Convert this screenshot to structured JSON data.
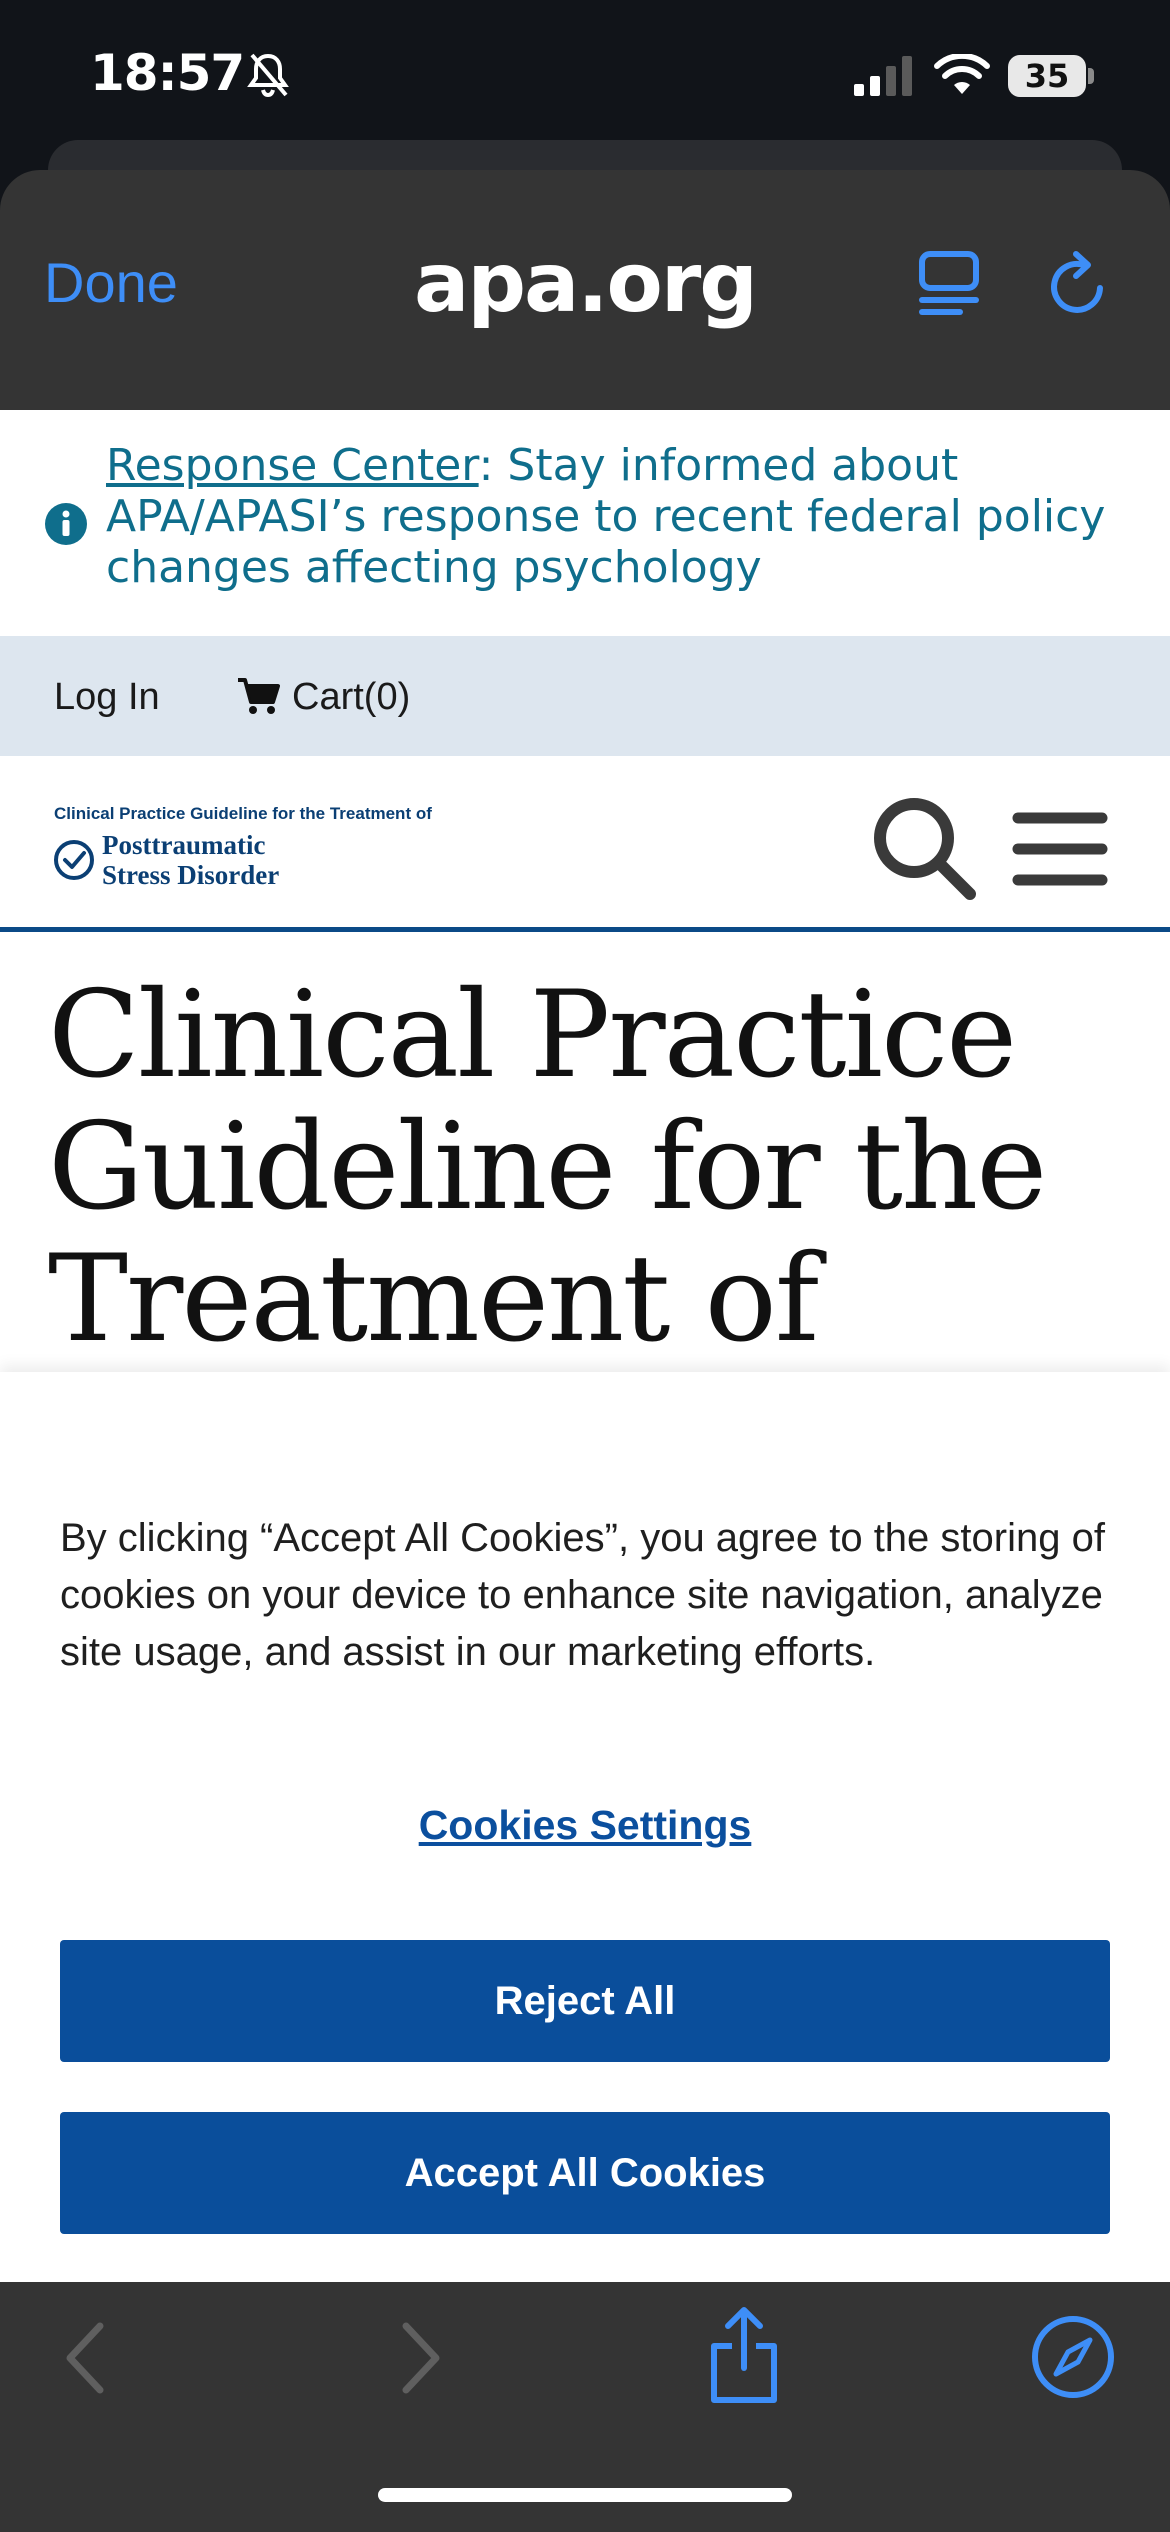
{
  "status_bar": {
    "time": "18:57",
    "battery": "35"
  },
  "browser": {
    "done_label": "Done",
    "domain": "apa.org"
  },
  "alert": {
    "link_text": "Response Center",
    "text": ": Stay informed about APA/APASI’s response to recent federal policy changes affecting psychology"
  },
  "utility_nav": {
    "login_label": "Log In",
    "cart_label": "Cart(0)"
  },
  "site_logo": {
    "top_line": "Clinical Practice Guideline for the Treatment of",
    "line1": "Posttraumatic",
    "line2": "Stress Disorder"
  },
  "page": {
    "title": "Clinical Practice Guideline for the Treatment of"
  },
  "cookie_banner": {
    "text": "By clicking “Accept All Cookies”, you agree to the storing of cookies on your device to enhance site navigation, analyze site usage, and assist in our marketing efforts.",
    "settings_label": "Cookies Settings",
    "reject_label": "Reject All",
    "accept_label": "Accept All Cookies"
  },
  "colors": {
    "ios_blue": "#3e8ef7",
    "apa_navy": "#0a4e9b",
    "alert_teal": "#0f6e8c",
    "utility_bg": "#dde6ef"
  },
  "icons": [
    "bell-slash-icon",
    "signal-icon",
    "wifi-icon",
    "reader-icon",
    "reload-icon",
    "info-icon",
    "cart-icon",
    "check-circle-icon",
    "search-icon",
    "menu-icon",
    "back-icon",
    "forward-icon",
    "share-icon",
    "compass-icon"
  ]
}
